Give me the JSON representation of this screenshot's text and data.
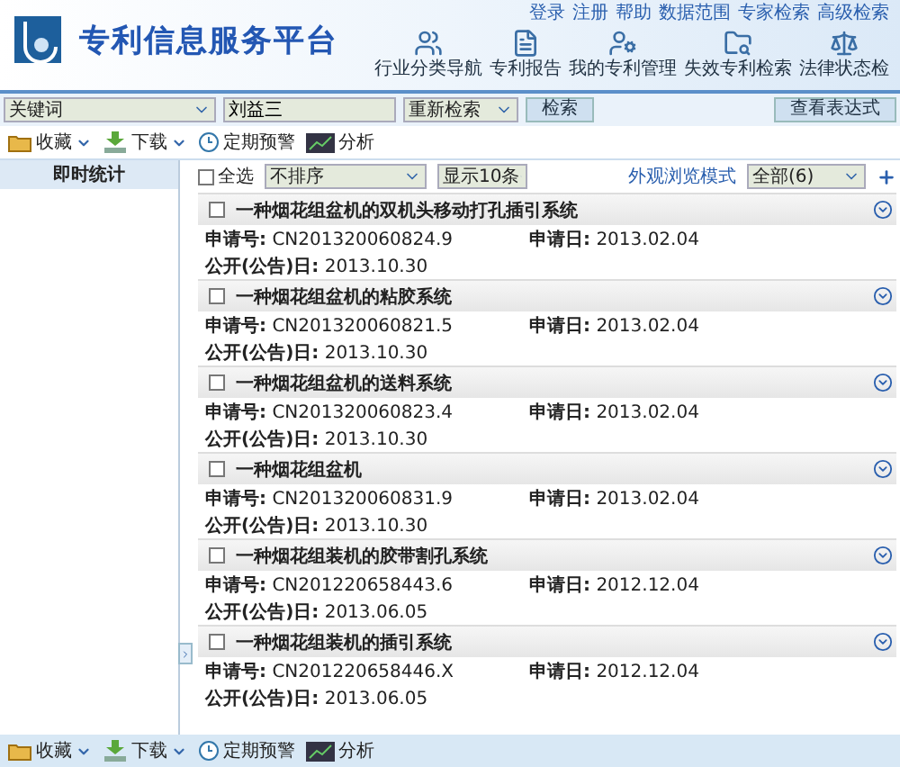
{
  "header": {
    "title": "专利信息服务平台",
    "top_links": [
      "登录",
      "注册",
      "帮助",
      "数据范围",
      "专家检索",
      "高级检索"
    ],
    "nav": [
      {
        "label": "行业分类导航",
        "kind": "guide"
      },
      {
        "label": "专利报告",
        "kind": "report"
      },
      {
        "label": "我的专利管理",
        "kind": "manage"
      },
      {
        "label": "失效专利检索",
        "kind": "expired"
      },
      {
        "label": "法律状态检",
        "kind": "legal"
      }
    ]
  },
  "search": {
    "field_select": "关键词",
    "query": "刘益三",
    "mode_select": "重新检索",
    "search_button": "检索",
    "expression_button": "查看表达式"
  },
  "toolbar": [
    {
      "label": "收藏",
      "kind": "favorite"
    },
    {
      "label": "下载",
      "kind": "download"
    },
    {
      "label": "定期预警",
      "kind": "alert"
    },
    {
      "label": "分析",
      "kind": "analysis"
    }
  ],
  "sidebar": {
    "title": "即时统计"
  },
  "list_controls": {
    "select_all": {
      "label": "全选",
      "checked": false
    },
    "sort": "不排序",
    "page_size": "显示10条",
    "view_mode_label": "外观浏览模式",
    "view_mode": "全部(6)"
  },
  "results": [
    {
      "title": "一种烟花组盆机的双机头移动打孔插引系统",
      "checked": false,
      "app_no_label": "申请号:",
      "app_no": "CN201320060824.9",
      "app_date_label": "申请日:",
      "app_date": "2013.02.04",
      "pub_date_label": "公开(公告)日:",
      "pub_date": "2013.10.30"
    },
    {
      "title": "一种烟花组盆机的粘胶系统",
      "checked": false,
      "app_no_label": "申请号:",
      "app_no": "CN201320060821.5",
      "app_date_label": "申请日:",
      "app_date": "2013.02.04",
      "pub_date_label": "公开(公告)日:",
      "pub_date": "2013.10.30"
    },
    {
      "title": "一种烟花组盆机的送料系统",
      "checked": false,
      "app_no_label": "申请号:",
      "app_no": "CN201320060823.4",
      "app_date_label": "申请日:",
      "app_date": "2013.02.04",
      "pub_date_label": "公开(公告)日:",
      "pub_date": "2013.10.30"
    },
    {
      "title": "一种烟花组盆机",
      "checked": false,
      "app_no_label": "申请号:",
      "app_no": "CN201320060831.9",
      "app_date_label": "申请日:",
      "app_date": "2013.02.04",
      "pub_date_label": "公开(公告)日:",
      "pub_date": "2013.10.30"
    },
    {
      "title": "一种烟花组装机的胶带割孔系统",
      "checked": false,
      "app_no_label": "申请号:",
      "app_no": "CN201220658443.6",
      "app_date_label": "申请日:",
      "app_date": "2012.12.04",
      "pub_date_label": "公开(公告)日:",
      "pub_date": "2013.06.05"
    },
    {
      "title": "一种烟花组装机的插引系统",
      "checked": false,
      "app_no_label": "申请号:",
      "app_no": "CN201220658446.X",
      "app_date_label": "申请日:",
      "app_date": "2012.12.04",
      "pub_date_label": "公开(公告)日:",
      "pub_date": "2013.06.05"
    }
  ],
  "bottom_toolbar": [
    {
      "label": "收藏",
      "kind": "favorite"
    },
    {
      "label": "下载",
      "kind": "download"
    },
    {
      "label": "定期预警",
      "kind": "alert"
    },
    {
      "label": "分析",
      "kind": "analysis"
    }
  ]
}
